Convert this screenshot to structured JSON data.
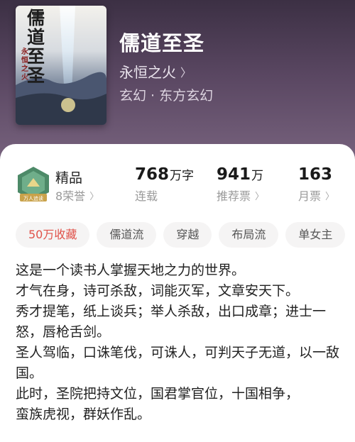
{
  "book": {
    "title": "儒道至圣",
    "author": "永恒之火",
    "genre": "玄幻 · 东方玄幻",
    "cover": {
      "title": "儒道至圣",
      "author": "永恒之火"
    }
  },
  "stats": {
    "quality": {
      "label": "精品",
      "honors": "8荣誉",
      "badge_text": "万人追读"
    },
    "word_count": {
      "value": "768",
      "unit": "万字",
      "label": "连载"
    },
    "recommend": {
      "value": "941",
      "unit": "万",
      "label": "推荐票"
    },
    "monthly": {
      "value": "163",
      "label": "月票"
    }
  },
  "tags": [
    "50万收藏",
    "儒道流",
    "穿越",
    "布局流",
    "单女主"
  ],
  "description": [
    "这是一个读书人掌握天地之力的世界。",
    "才气在身，诗可杀敌，词能灭军，文章安天下。",
    "秀才提笔，纸上谈兵；举人杀敌，出口成章；进士一怒，唇枪舌剑。",
    "圣人驾临，口诛笔伐，可诛人，可判天子无道，以一敌国。",
    "此时，圣院把持文位，国君掌官位，十国相争，",
    "蛮族虎视，群妖作乱。"
  ],
  "colors": {
    "accent": "#e0524a",
    "header_bg": "#5a4762",
    "badge_green": "#4d8a68",
    "badge_gold": "#c9a24a"
  },
  "icons": {
    "chevron": "chevron-right-icon",
    "badge": "honor-badge-icon"
  }
}
